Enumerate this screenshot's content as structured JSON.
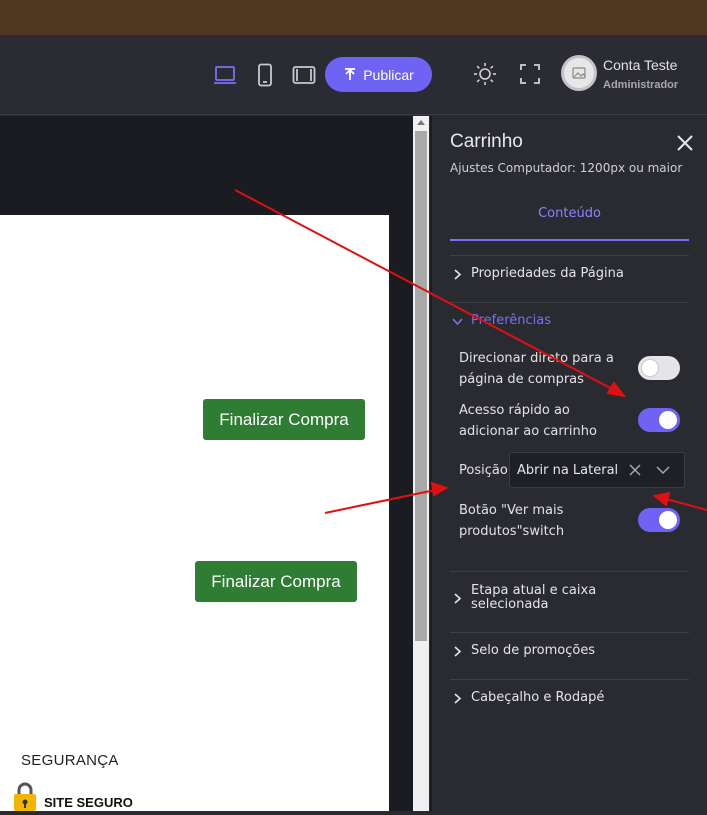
{
  "header": {
    "publish_label": "Publicar",
    "user_name": "Conta Teste",
    "user_role": "Administrador"
  },
  "devices": [
    "desktop-icon",
    "mobile-icon",
    "tablet-icon"
  ],
  "canvas": {
    "buttons": [
      "Finalizar Compra",
      "Finalizar Compra"
    ],
    "security_heading": "SEGURANÇA",
    "site_seal": "SITE SEGURO"
  },
  "panel": {
    "title": "Carrinho",
    "subtitle": "Ajustes Computador: 1200px ou maior",
    "tab": "Conteúdo",
    "sections": {
      "page_props": "Propriedades da Página",
      "preferences": "Preferências",
      "current_step": "Etapa atual e caixa selecionada",
      "promo_seal": "Selo de promoções",
      "header_footer": "Cabeçalho e Rodapé"
    },
    "options": {
      "direct_label": "Direcionar direto para a página de compras",
      "direct_on": false,
      "quick_label": "Acesso rápido ao adicionar ao carrinho",
      "quick_on": true,
      "position_label": "Posição",
      "position_value": "Abrir na Lateral",
      "more_label": "Botão \"Ver mais produtos\"switch",
      "more_on": true
    }
  },
  "colors": {
    "accent": "#6e63f2",
    "green_button": "#2e7d32",
    "annotation_arrow": "#e01010"
  }
}
